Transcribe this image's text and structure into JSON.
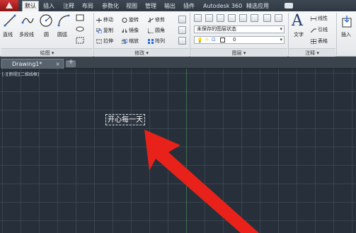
{
  "menubar": {
    "tabs": [
      {
        "label": "默认",
        "active": true
      },
      {
        "label": "插入",
        "active": false
      },
      {
        "label": "注释",
        "active": false
      },
      {
        "label": "布局",
        "active": false
      },
      {
        "label": "参数化",
        "active": false
      },
      {
        "label": "视图",
        "active": false
      },
      {
        "label": "管理",
        "active": false
      },
      {
        "label": "输出",
        "active": false
      },
      {
        "label": "插件",
        "active": false
      },
      {
        "label": "Autodesk 360",
        "active": false
      },
      {
        "label": "精选应用",
        "active": false
      }
    ]
  },
  "ribbon": {
    "draw": {
      "line_label": "直线",
      "polyline_label": "多段线",
      "circle_label": "圆",
      "arc_label": "圆弧",
      "panel_title": "绘图 ▾"
    },
    "modify": {
      "move": "移动",
      "rotate": "旋转",
      "trim": "修剪",
      "copy": "复制",
      "mirror": "镜像",
      "fillet": "圆角",
      "stretch": "拉伸",
      "scale": "缩放",
      "array": "阵列",
      "panel_title": "修改 ▾"
    },
    "layers": {
      "layer_state": "未保存的图层状态",
      "current_layer": "0",
      "panel_title": "图层 ▾"
    },
    "annotation": {
      "text_label": "文字",
      "linear_label": "线性",
      "leader_label": "引线",
      "table_label": "表格",
      "panel_title": "注释 ▾"
    },
    "block": {
      "insert_label": "插入"
    }
  },
  "tabbar": {
    "doc_tab": "Drawing1*",
    "close": "×"
  },
  "drawing": {
    "viewport_label": "[-][俯视][二维线框]",
    "mtext": "开心每一天"
  },
  "colors": {
    "canvas": "#27303a",
    "arrow": "#e8221a",
    "app_button": "#c33333"
  }
}
